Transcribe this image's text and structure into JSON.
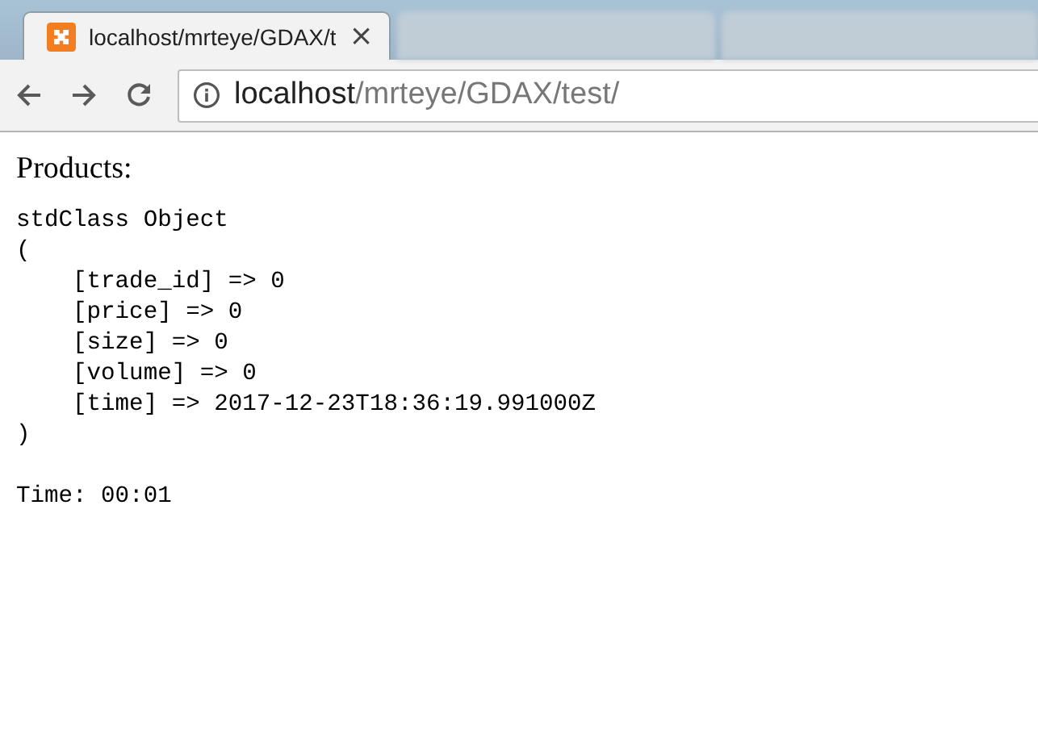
{
  "browser": {
    "tabs": [
      {
        "title": "localhost/mrteye/GDAX/t",
        "selected": true,
        "close": "×"
      },
      {
        "selected": false
      },
      {
        "selected": false
      }
    ],
    "address": {
      "host": "localhost",
      "path": "/mrteye/GDAX/test/"
    }
  },
  "page": {
    "heading": "Products:",
    "dump_lines": [
      "stdClass Object",
      "(",
      "    [trade_id] => 0",
      "    [price] => 0",
      "    [size] => 0",
      "    [volume] => 0",
      "    [time] => 2017-12-23T18:36:19.991000Z",
      ")"
    ],
    "time_line": "Time: 00:01"
  }
}
